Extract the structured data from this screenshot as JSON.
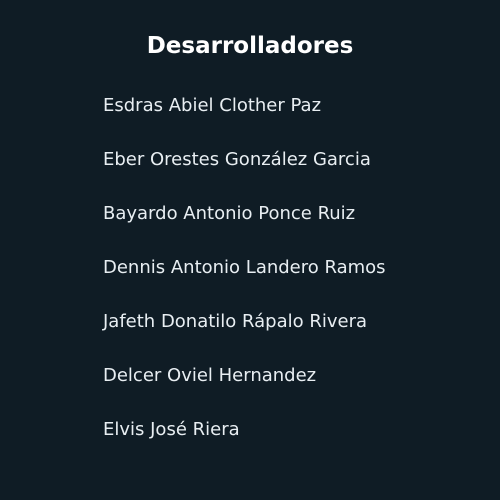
{
  "colors": {
    "background": "#0f1c25",
    "title": "#ffffff",
    "text": "#e8eef2"
  },
  "title": "Desarrolladores",
  "developers": [
    "Esdras Abiel Clother Paz",
    "Eber Orestes González Garcia",
    "Bayardo Antonio Ponce Ruiz",
    "Dennis Antonio Landero Ramos",
    "Jafeth Donatilo Rápalo Rivera",
    "Delcer Oviel Hernandez",
    "Elvis José Riera"
  ]
}
